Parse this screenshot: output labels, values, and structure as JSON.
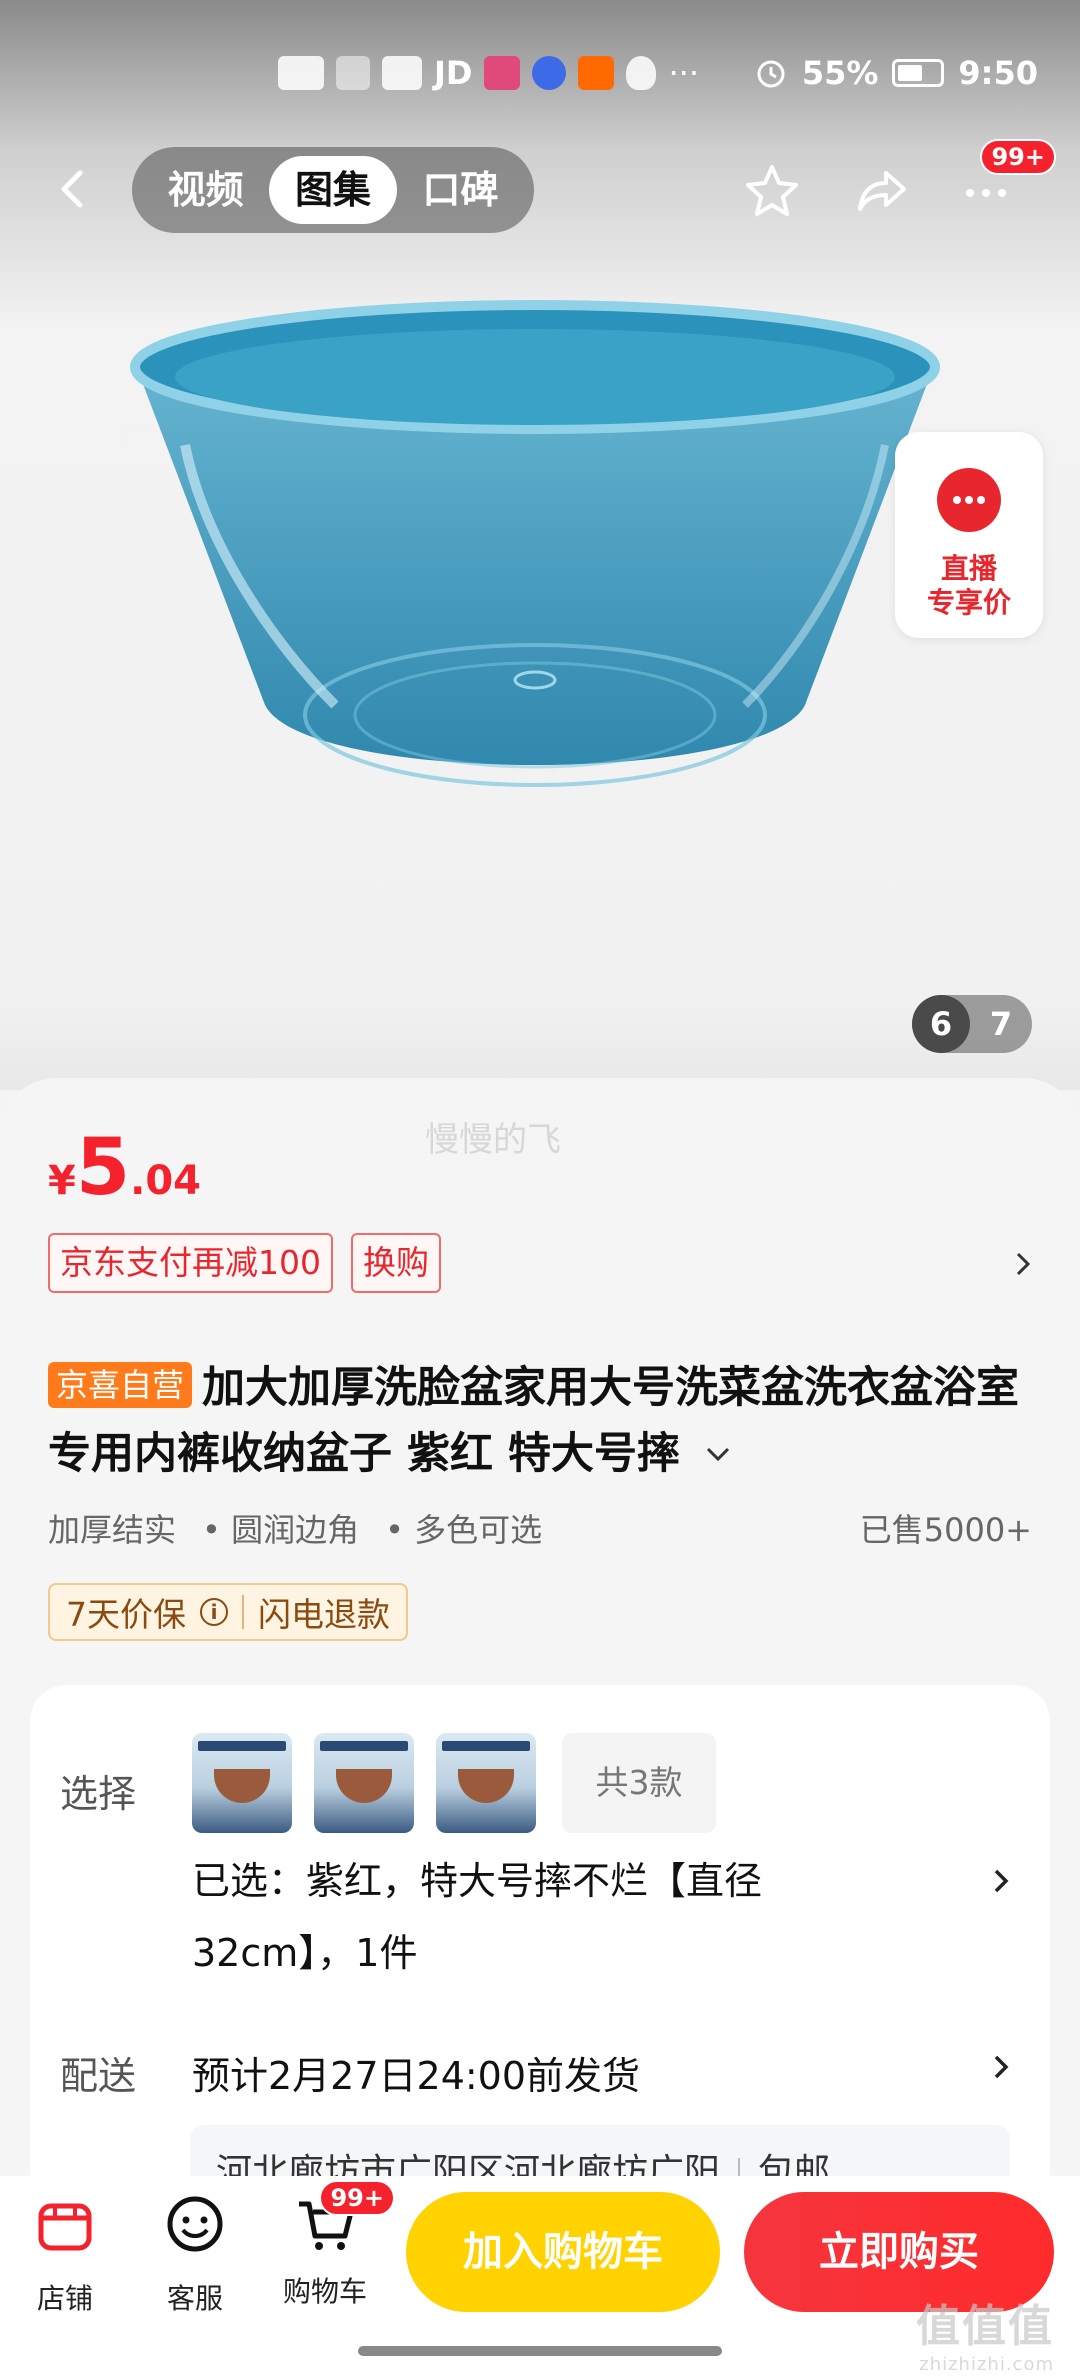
{
  "status_bar": {
    "battery": "55%",
    "time": "9:50",
    "carrier": "JD"
  },
  "nav": {
    "tabs": [
      {
        "label": "视频",
        "active": false
      },
      {
        "label": "图集",
        "active": true
      },
      {
        "label": "口碑",
        "active": false
      }
    ],
    "more_badge": "99+"
  },
  "live_card": {
    "line1": "直播",
    "line2": "专享价"
  },
  "gallery": {
    "current": "6",
    "total": "7"
  },
  "watermark": "慢慢的飞",
  "price": {
    "currency": "¥",
    "integer": "5",
    "decimal": ".04",
    "color": "#f5222d"
  },
  "promos": [
    "京东支付再减100",
    "换购"
  ],
  "product": {
    "self_tag": "京喜自营",
    "title": "加大加厚洗脸盆家用大号洗菜盆洗衣盆浴室专用内裤收纳盆子 紫红 特大号摔",
    "features": [
      "加厚结实",
      "• 圆润边角",
      "• 多色可选"
    ],
    "sold": "已售5000+"
  },
  "guarantee": {
    "price_protect": "7天价保",
    "refund": "闪电退款"
  },
  "select": {
    "label": "选择",
    "more": "共3款",
    "selected": "已选：紫红，特大号摔不烂【直径32cm】，1件"
  },
  "delivery": {
    "label": "配送",
    "eta": "预计2月27日24:00前发货",
    "address": "河北廊坊市广阳区河北廊坊广阳",
    "shipping": "包邮"
  },
  "bottom_bar": {
    "store": "店铺",
    "service": "客服",
    "cart": "购物车",
    "cart_badge": "99+",
    "add_to_cart": "加入购物车",
    "buy_now": "立即购买"
  },
  "site_mark": {
    "main": "值值值",
    "sub": "zhizhizhi.com"
  },
  "colors": {
    "accent": "#f5222d",
    "cart_button": "#ffd200",
    "product": "#2f8bb0"
  }
}
